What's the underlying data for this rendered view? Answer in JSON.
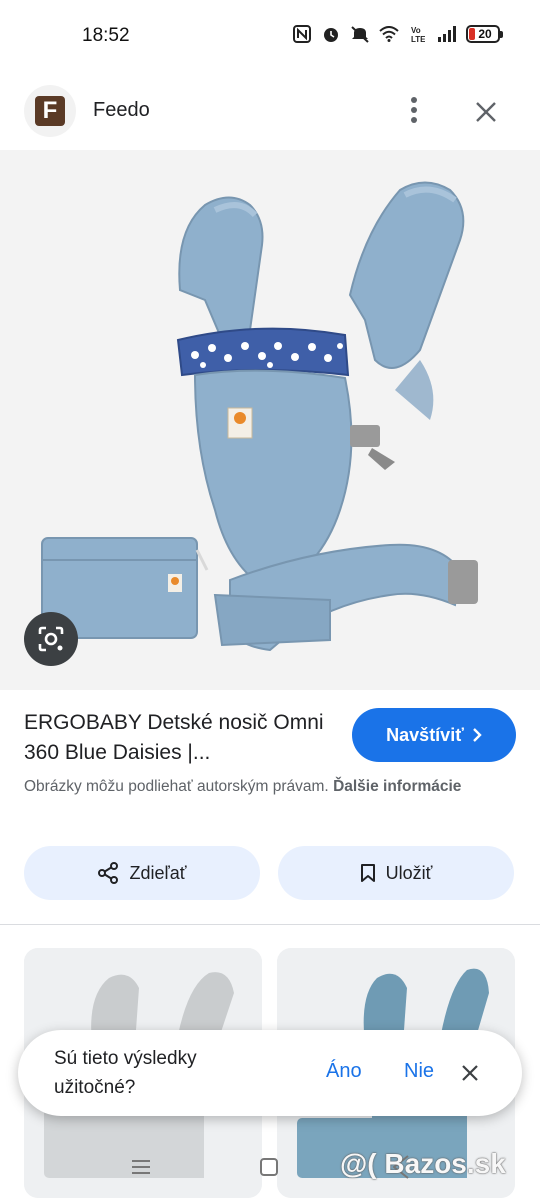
{
  "status_bar": {
    "time": "18:52",
    "battery": "20",
    "icons": [
      "nfc-icon",
      "alarm-icon",
      "mute-icon",
      "wifi-icon",
      "volte-icon",
      "signal-icon",
      "battery-icon"
    ]
  },
  "header": {
    "site_logo_letter": "F",
    "site_name": "Feedo"
  },
  "result": {
    "title": "ERGOBABY Detské nosič Omni 360 Blue Daisies |...",
    "visit_label": "Navštíviť",
    "copyright_text": "Obrázky môžu podliehať autorským právam.",
    "copyright_link": "Ďalšie informácie"
  },
  "actions": {
    "share_label": "Zdieľať",
    "save_label": "Uložiť"
  },
  "feedback": {
    "question": "Sú tieto výsledky užitočné?",
    "yes": "Áno",
    "no": "Nie"
  },
  "watermark": "@( Bazos.sk",
  "colors": {
    "accent": "#1a73e8",
    "chip_bg": "#e8f0fe",
    "carrier_blue": "#8fb0cc"
  }
}
